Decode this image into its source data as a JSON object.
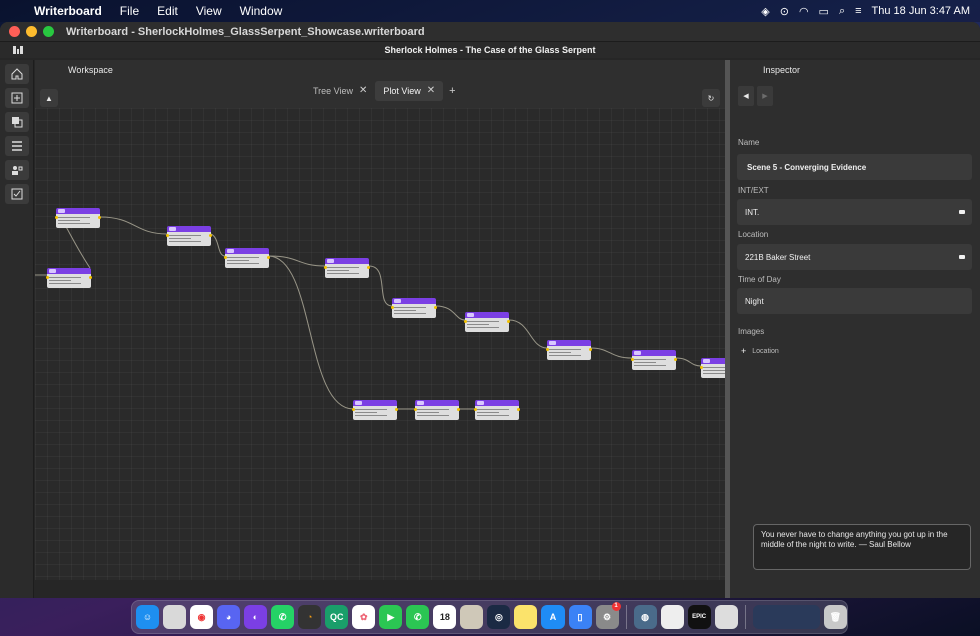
{
  "menubar": {
    "app_name": "Writerboard",
    "menus": [
      "File",
      "Edit",
      "View",
      "Window"
    ],
    "datetime": "Thu 18 Jun  3:47 AM"
  },
  "window": {
    "title": "Writerboard - SherlockHolmes_GlassSerpent_Showcase.writerboard",
    "header": "Sherlock Holmes - The Case of the Glass Serpent"
  },
  "workspace": {
    "label": "Workspace",
    "tabs": [
      {
        "label": "Tree View",
        "active": false
      },
      {
        "label": "Plot View",
        "active": true
      }
    ],
    "add_tab": "+",
    "nodes_count_visible": 14
  },
  "inspector": {
    "title": "Inspector",
    "nav_back": "◀",
    "nav_forward": "▶",
    "name_label": "Name",
    "name_value": "Scene 5 - Converging Evidence",
    "intext_label": "INT/EXT",
    "intext_value": "INT.",
    "location_label": "Location",
    "location_value": "221B Baker Street",
    "time_label": "Time of Day",
    "time_value": "Night",
    "images_label": "Images",
    "add_location": "Location"
  },
  "quote": "You never have to change anything you got up in the middle of the night to write. — Saul Bellow",
  "colors": {
    "node_header": "#7b3fe4",
    "node_body": "#dedede",
    "wire": "#bdb9a6",
    "port": "#f2c200"
  },
  "dock_icons": [
    "finder-icon",
    "launchpad-icon",
    "chrome-icon",
    "discord-icon",
    "github-icon",
    "whatsapp-icon",
    "blender-icon",
    "qc-icon",
    "photos-icon",
    "facetime-icon",
    "phone-icon",
    "calendar-icon",
    "preview-icon",
    "safari-icon",
    "notes-icon",
    "appstore-icon",
    "simulator-icon",
    "settings-icon",
    "disk-icon",
    "textedit-icon",
    "epic-icon",
    "app-icon",
    "screenshot-icon",
    "trash-icon"
  ],
  "dock_labels": {
    "qc": "QC",
    "calendar": "18",
    "epic": "EPIC",
    "settings_badge": "1"
  }
}
